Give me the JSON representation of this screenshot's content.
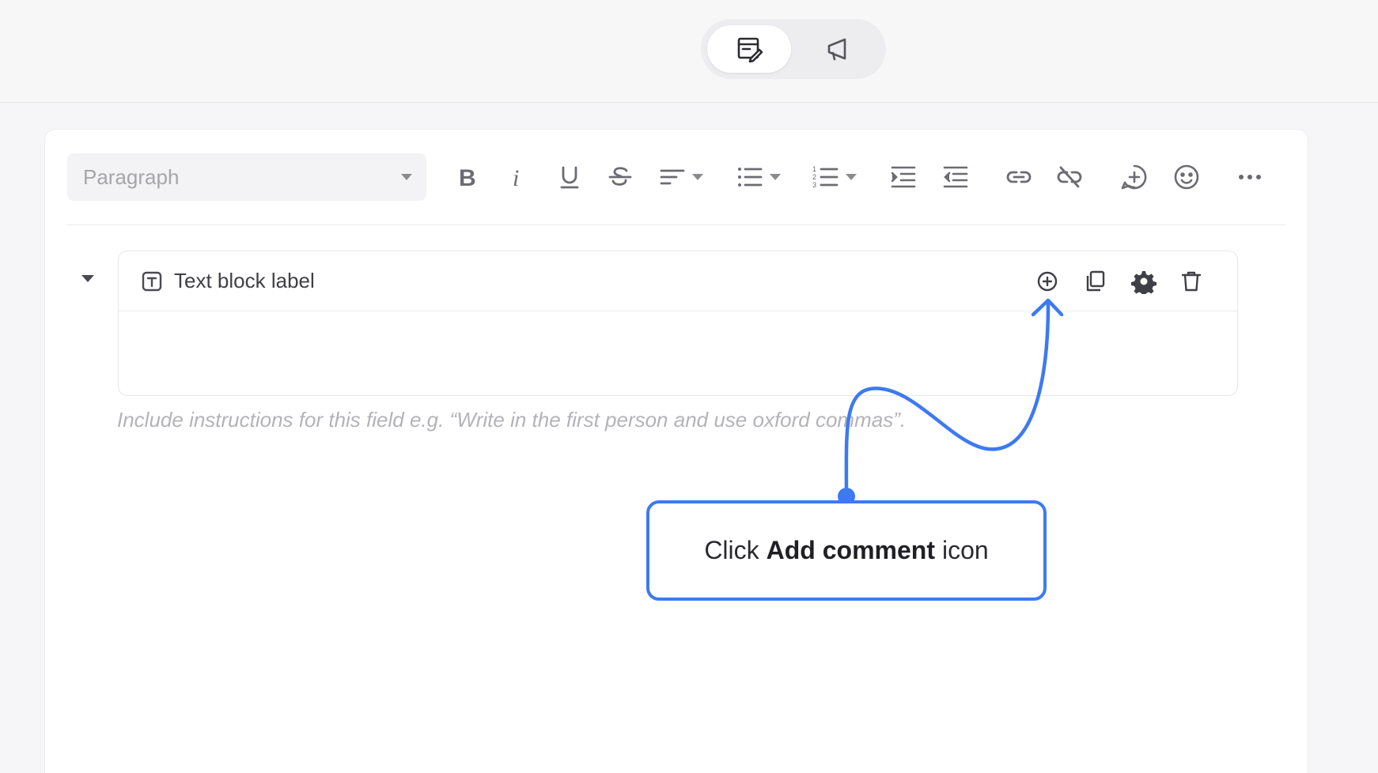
{
  "header": {
    "modes": [
      {
        "icon": "edit-note-icon",
        "active": true
      },
      {
        "icon": "megaphone-icon",
        "active": false
      }
    ]
  },
  "toolbar": {
    "paragraph_select": "Paragraph",
    "icons": [
      "bold-icon",
      "italic-icon",
      "underline-icon",
      "strikethrough-icon",
      "align-icon",
      "bullet-list-icon",
      "numbered-list-icon",
      "indent-icon",
      "outdent-icon",
      "link-icon",
      "unlink-icon",
      "add-comment-icon",
      "emoji-icon",
      "more-icon"
    ]
  },
  "block": {
    "label": "Text block label",
    "instructions_placeholder": "Include instructions for this field e.g. “Write in the first person and use oxford commas”."
  },
  "callout": {
    "prefix": "Click",
    "bold": "Add comment",
    "suffix": "icon"
  },
  "colors": {
    "accent": "#3d7af0",
    "icon": "#6b6b72",
    "muted_text": "#b3b3b8"
  }
}
